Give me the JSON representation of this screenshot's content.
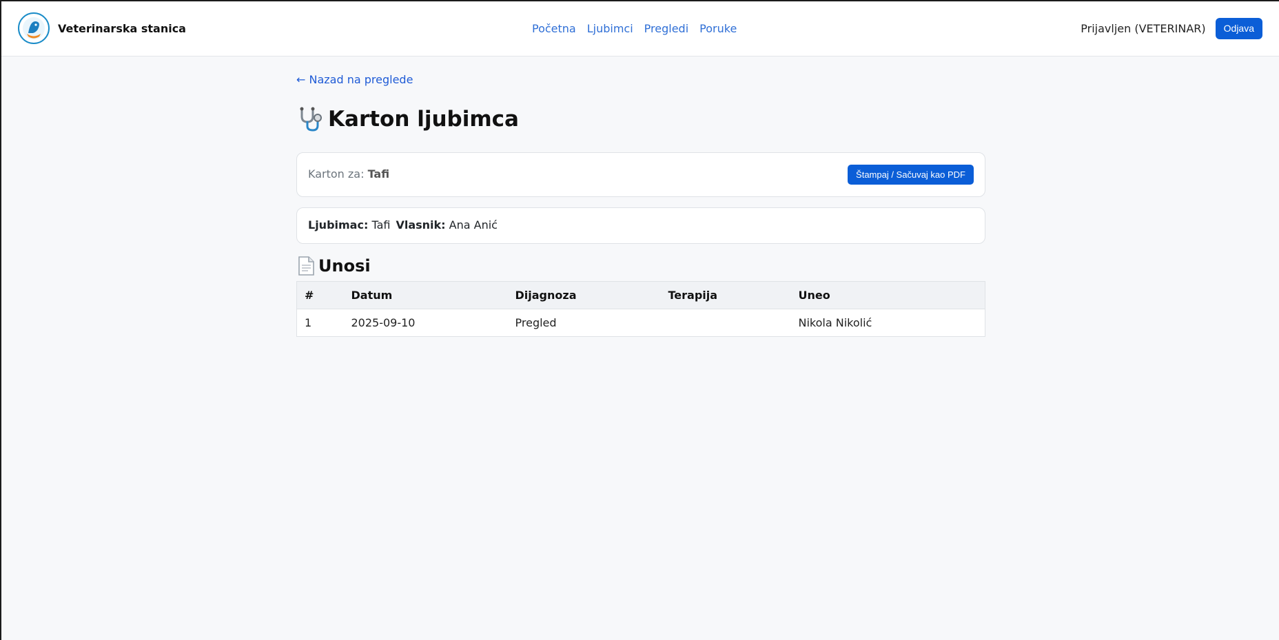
{
  "navbar": {
    "brand_name": "Veterinarska stanica",
    "links": [
      "Početna",
      "Ljubimci",
      "Pregledi",
      "Poruke"
    ],
    "login_status": "Prijavljen (VETERINAR)",
    "logout_label": "Odjava"
  },
  "page": {
    "back_link": "← Nazad na preglede",
    "title": "Karton ljubimca",
    "record_for_label": "Karton za:",
    "record_for_value": "Tafi",
    "print_button": "Štampaj / Sačuvaj kao PDF"
  },
  "info": {
    "pet_label": "Ljubimac:",
    "pet_value": "Tafi",
    "owner_label": "Vlasnik:",
    "owner_value": "Ana Anić"
  },
  "entries": {
    "heading": "Unosi",
    "columns": [
      "#",
      "Datum",
      "Dijagnoza",
      "Terapija",
      "Uneo"
    ],
    "rows": [
      [
        "1",
        "2025-09-10",
        "Pregled",
        "",
        "Nikola Nikolić"
      ]
    ]
  },
  "colors": {
    "primary": "#0b5ed7",
    "link": "#2f6fd6",
    "background": "#f7f8fa"
  },
  "icons": {
    "logo": "clinic-logo",
    "title": "stethoscope-icon",
    "section": "document-icon"
  }
}
